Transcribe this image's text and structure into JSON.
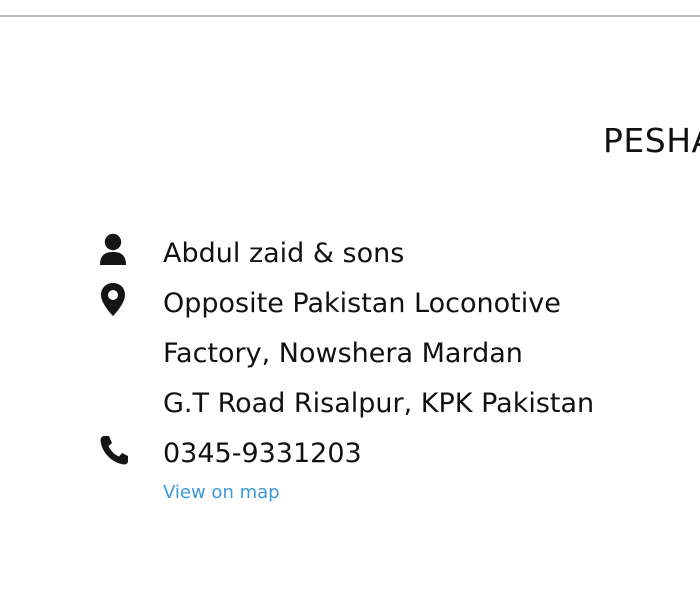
{
  "location": {
    "city_heading": "PESHA"
  },
  "contact": {
    "name": "Abdul zaid & sons",
    "address_lines": [
      "Opposite Pakistan Loconotive",
      "Factory, Nowshera Mardan",
      "G.T Road Risalpur, KPK Pakistan"
    ],
    "phone": "0345-9331203",
    "map_link_label": "View on map"
  },
  "icons": {
    "name": "person-icon",
    "address": "map-pin-icon",
    "phone": "phone-icon"
  },
  "colors": {
    "text": "#111111",
    "link": "#3b97db",
    "divider": "#b9b9b9"
  }
}
